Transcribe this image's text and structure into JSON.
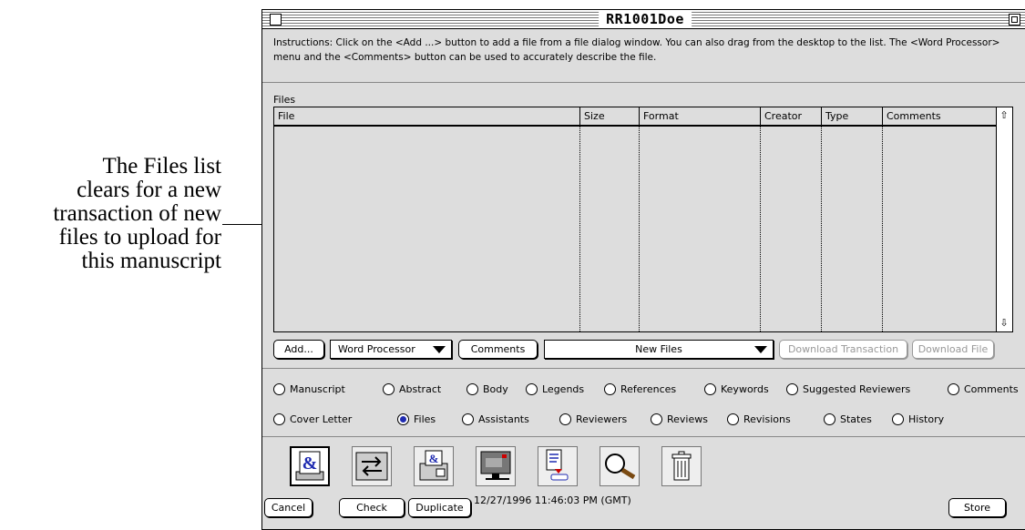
{
  "annotation": {
    "lines": [
      "The Files list",
      "clears for a new",
      "transaction of new",
      "files to upload for",
      "this manuscript"
    ]
  },
  "window": {
    "title": "RR1001Doe",
    "instructions": "Instructions: Click on the <Add ...> button to add a file from a file dialog window.  You can also drag from the desktop to the list.  The <Word Processor> menu and the <Comments> button can be used to accurately describe the file."
  },
  "files": {
    "label": "Files",
    "columns": [
      "File",
      "Size",
      "Format",
      "Creator",
      "Type",
      "Comments"
    ],
    "rows": []
  },
  "actions": {
    "add": "Add...",
    "word_processor": "Word Processor",
    "comments": "Comments",
    "transaction_select": "New Files",
    "download_transaction": "Download Transaction",
    "download_file": "Download File"
  },
  "sections_row1": [
    "Manuscript",
    "Abstract",
    "Body",
    "Legends",
    "References",
    "Keywords",
    "Suggested Reviewers",
    "Comments"
  ],
  "sections_row2": [
    "Cover Letter",
    "Files",
    "Assistants",
    "Reviewers",
    "Reviews",
    "Revisions",
    "States",
    "History"
  ],
  "selected_section": "Files",
  "toolbar_icons": [
    "ampersand-printer-icon",
    "transfer-arrows-icon",
    "fax-machine-icon",
    "computer-monitor-icon",
    "document-send-icon",
    "magnifier-icon",
    "trash-can-icon"
  ],
  "footer": {
    "cancel": "Cancel",
    "check": "Check",
    "duplicate": "Duplicate",
    "timestamp": "12/27/1996 11:46:03 PM (GMT)",
    "store": "Store"
  },
  "colors": {
    "window_bg": "#dddddd",
    "radio_selected": "#1f2bb0"
  }
}
